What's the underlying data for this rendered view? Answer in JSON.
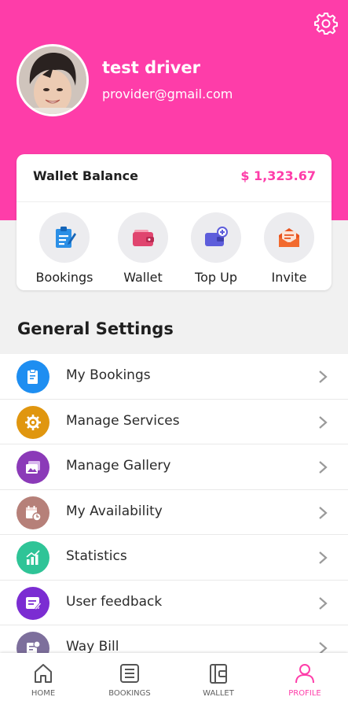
{
  "profile": {
    "name": "test driver",
    "email": "provider@gmail.com"
  },
  "wallet": {
    "title": "Wallet Balance",
    "amount": "$ 1,323.67"
  },
  "quick_actions": [
    {
      "label": "Bookings",
      "icon": "bookings-clipboard-icon"
    },
    {
      "label": "Wallet",
      "icon": "wallet-icon"
    },
    {
      "label": "Top Up",
      "icon": "top-up-wallet-icon"
    },
    {
      "label": "Invite",
      "icon": "invite-envelope-icon"
    }
  ],
  "section": {
    "title": "General Settings"
  },
  "menu": [
    {
      "label": "My Bookings",
      "icon": "clipboard-icon",
      "color": "#1e8ef1"
    },
    {
      "label": "Manage Services",
      "icon": "gear-icon",
      "color": "#e0960f"
    },
    {
      "label": "Manage Gallery",
      "icon": "gallery-icon",
      "color": "#8b3ab8"
    },
    {
      "label": "My Availability",
      "icon": "calendar-clock-icon",
      "color": "#b68079"
    },
    {
      "label": "Statistics",
      "icon": "chart-icon",
      "color": "#2fc497"
    },
    {
      "label": "User feedback",
      "icon": "feedback-icon",
      "color": "#7b2dd2"
    },
    {
      "label": "Way Bill",
      "icon": "waybill-icon",
      "color": "#7d6f9c"
    }
  ],
  "nav": [
    {
      "label": "HOME",
      "icon": "home-icon"
    },
    {
      "label": "BOOKINGS",
      "icon": "bookings-list-icon"
    },
    {
      "label": "WALLET",
      "icon": "wallet-nav-icon"
    },
    {
      "label": "PROFILE",
      "icon": "profile-icon",
      "active": true
    }
  ],
  "colors": {
    "brand": "#fe3da9",
    "background": "#f1f1f1"
  }
}
